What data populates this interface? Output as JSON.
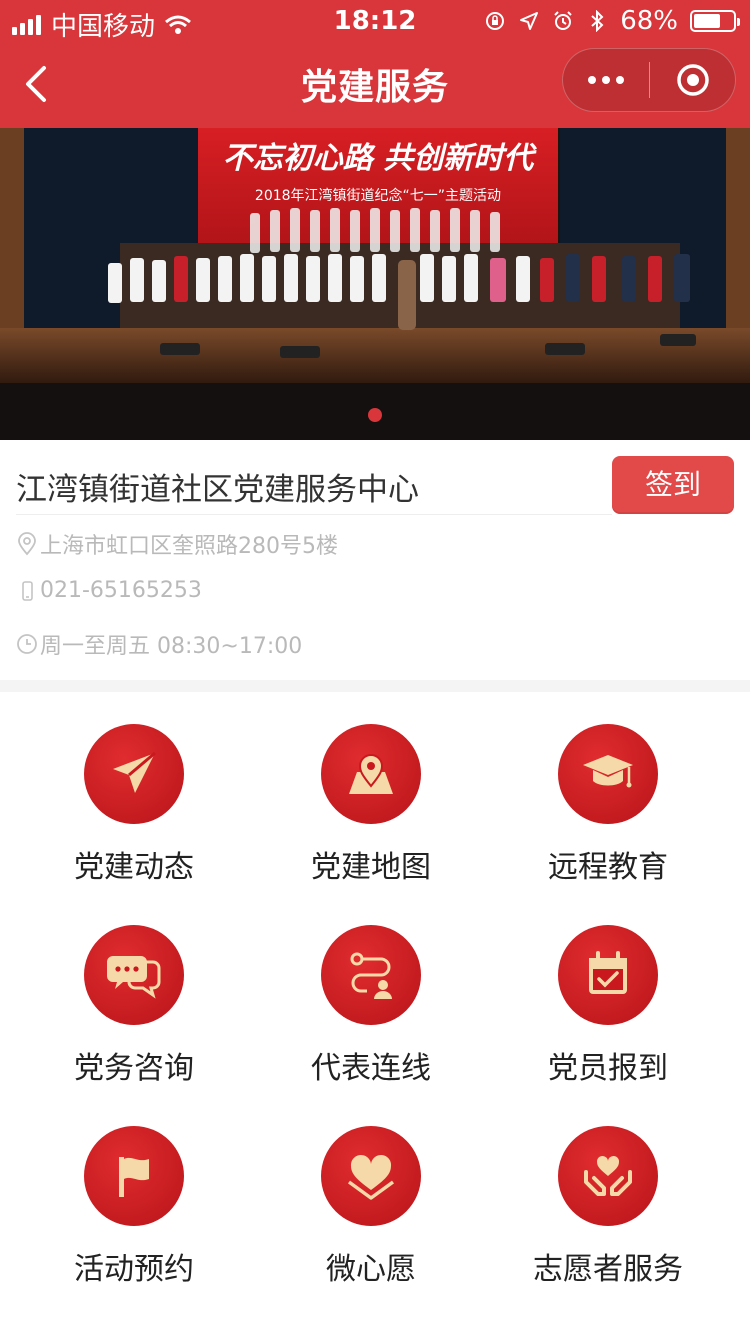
{
  "status_bar": {
    "carrier": "中国移动",
    "time": "18:12",
    "battery": "68%",
    "battery_level": 0.68
  },
  "nav": {
    "title": "党建服务"
  },
  "banner": {
    "headline": "不忘初心路 共创新时代",
    "subline": "2018年江湾镇街道纪念“七一”主题活动"
  },
  "center": {
    "name": "江湾镇街道社区党建服务中心",
    "checkin_label": "签到",
    "address": "上海市虹口区奎照路280号5楼",
    "phone": "021-65165253",
    "hours": "周一至周五 08:30~17:00"
  },
  "services": [
    {
      "label": "党建动态",
      "icon": "paper-plane-icon"
    },
    {
      "label": "党建地图",
      "icon": "map-pin-icon"
    },
    {
      "label": "远程教育",
      "icon": "graduation-cap-icon"
    },
    {
      "label": "党务咨询",
      "icon": "chat-bubbles-icon"
    },
    {
      "label": "代表连线",
      "icon": "route-person-icon"
    },
    {
      "label": "党员报到",
      "icon": "calendar-check-icon"
    },
    {
      "label": "活动预约",
      "icon": "flag-icon"
    },
    {
      "label": "微心愿",
      "icon": "heart-icon"
    },
    {
      "label": "志愿者服务",
      "icon": "hands-heart-icon"
    }
  ],
  "colors": {
    "brand_red": "#d8363a",
    "icon_red": "#c9191f",
    "icon_fill": "#f6d9a8"
  }
}
